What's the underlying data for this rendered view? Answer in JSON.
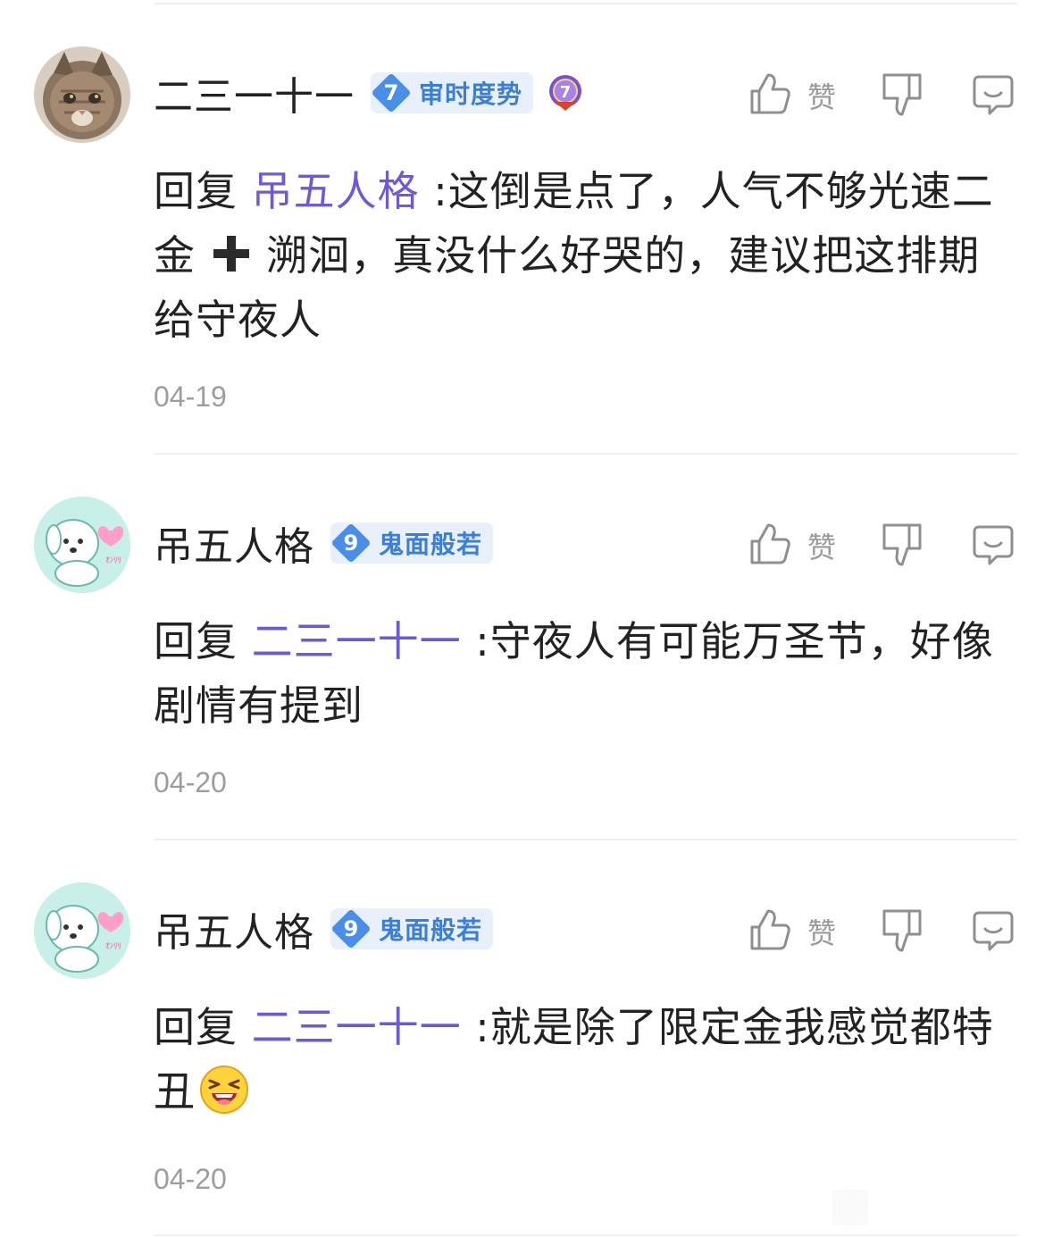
{
  "comments": [
    {
      "username": "二三一十一",
      "level": "7",
      "level_title": "审时度势",
      "avatar_icon": "cat-photo-avatar",
      "medal_icon": "level-7-medal-icon",
      "like_label": "赞",
      "reply_prefix": "回复",
      "mention": "吊五人格",
      "separator": ":",
      "text_part1": "这倒是点了，人气不够光速二金",
      "emoji_plus": "heavy-plus-emoji",
      "text_part2": "溯洄，真没什么好哭的，建议把这排期给守夜人",
      "time": "04-19"
    },
    {
      "username": "吊五人格",
      "level": "9",
      "level_title": "鬼面般若",
      "avatar_icon": "pochacco-avatar",
      "like_label": "赞",
      "reply_prefix": "回复",
      "mention": "二三一十一",
      "separator": ":",
      "text_part1": "守夜人有可能万圣节，好像剧情有提到",
      "time": "04-20"
    },
    {
      "username": "吊五人格",
      "level": "9",
      "level_title": "鬼面般若",
      "avatar_icon": "pochacco-avatar",
      "like_label": "赞",
      "reply_prefix": "回复",
      "mention": "二三一十一",
      "separator": ":",
      "text_part1": "就是除了限定金我感觉都特丑",
      "emoji_laugh": "laughing-emoji",
      "time": "04-20"
    }
  ],
  "colors": {
    "mention": "#6b5cd6",
    "badge_bg": "#e8f0fb",
    "badge_text": "#3a7ed9",
    "time": "#9d9d9d"
  }
}
